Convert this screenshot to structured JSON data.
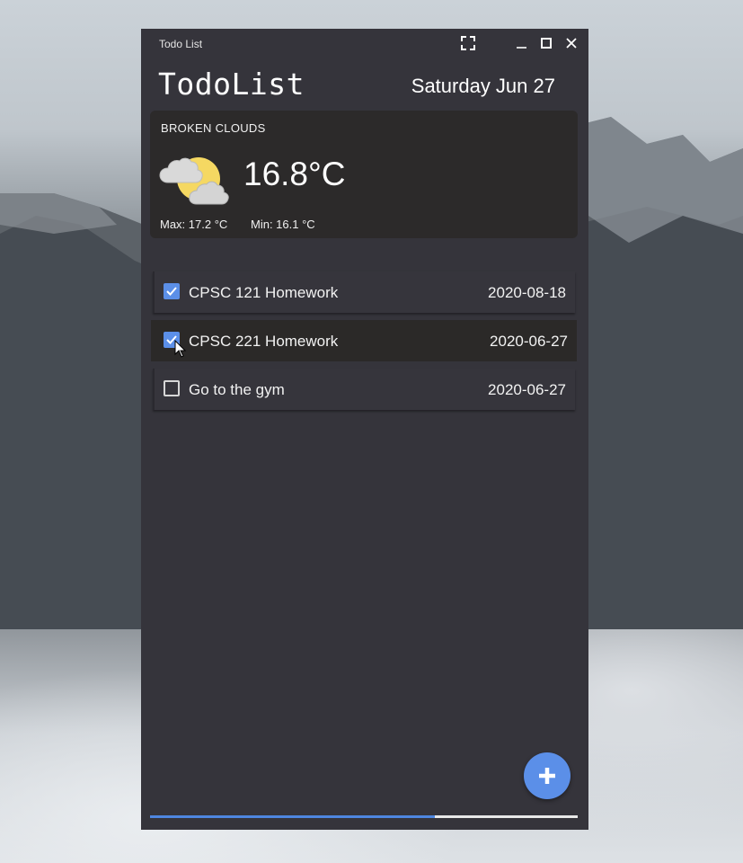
{
  "window": {
    "title": "Todo List",
    "controls": {
      "fullscreen": "fullscreen-icon",
      "minimize": "minimize-icon",
      "maximize": "maximize-icon",
      "close": "close-icon"
    }
  },
  "header": {
    "app_title": "TodoList",
    "date": "Saturday Jun 27"
  },
  "weather": {
    "condition": "BROKEN CLOUDS",
    "icon": "partly-cloudy-icon",
    "temperature": "16.8°C",
    "max": "Max: 17.2 °C",
    "min": "Min: 16.1 °C"
  },
  "todos": [
    {
      "text": "CPSC 121 Homework",
      "date": "2020-08-18",
      "done": true
    },
    {
      "text": "CPSC 221 Homework",
      "date": "2020-06-27",
      "done": true
    },
    {
      "text": "Go to the gym",
      "date": "2020-06-27",
      "done": false
    }
  ],
  "fab": {
    "icon": "plus-icon"
  },
  "progress": {
    "value": 0.666
  },
  "colors": {
    "window_bg": "#35343b",
    "card_bg": "#2c2a2a",
    "accent": "#5b8fe8",
    "progress": "#4e86e0"
  }
}
